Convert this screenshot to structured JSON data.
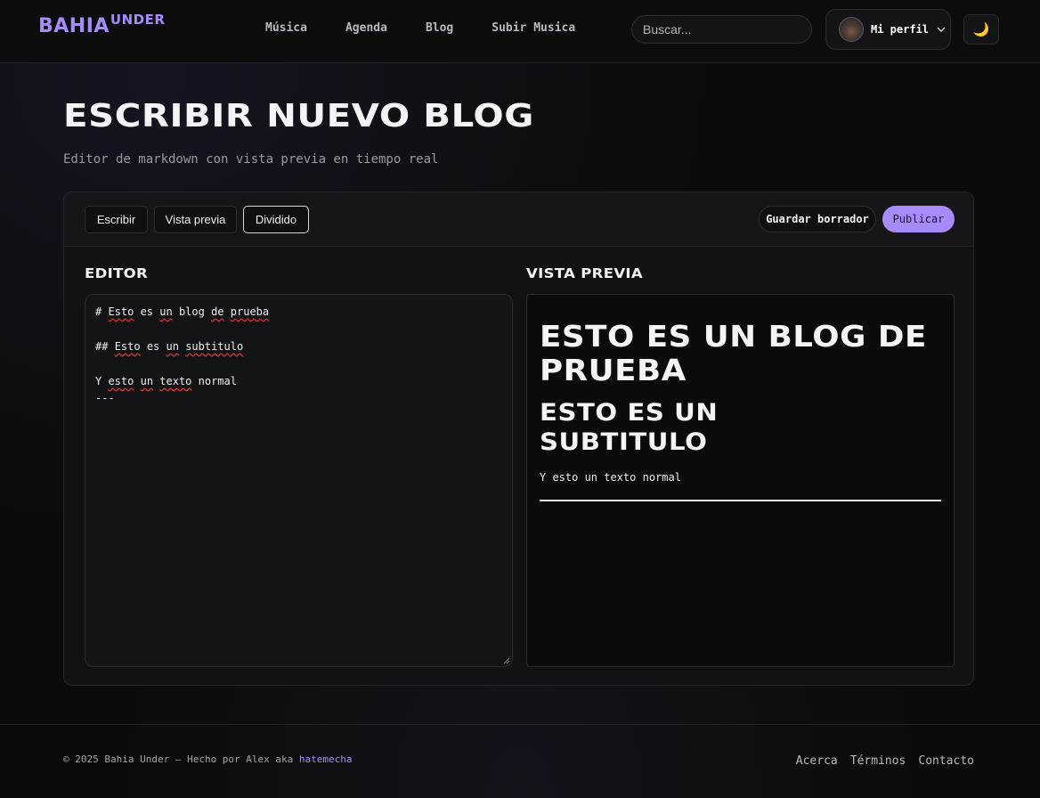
{
  "header": {
    "logo_main": "BAHIA",
    "logo_sup": "UNDER",
    "nav": [
      "Música",
      "Agenda",
      "Blog",
      "Subir Musica"
    ],
    "search_placeholder": "Buscar...",
    "profile_label": "Mi perfil",
    "theme_icon": "🌙"
  },
  "page": {
    "title": "ESCRIBIR NUEVO BLOG",
    "subtitle": "Editor de markdown con vista previa en tiempo real"
  },
  "toolbar": {
    "tabs": [
      "Escribir",
      "Vista previa",
      "Dividido"
    ],
    "active_tab": "Dividido",
    "draft_label": "Guardar borrador",
    "publish_label": "Publicar"
  },
  "editor": {
    "heading": "EDITOR",
    "lines": [
      "# Esto es un blog de prueba",
      "",
      "## Esto es un subtitulo",
      "",
      "Y esto un texto normal",
      "---"
    ]
  },
  "preview": {
    "heading": "VISTA PREVIA",
    "h1": "ESTO ES UN BLOG DE PRUEBA",
    "h2": "ESTO ES UN SUBTITULO",
    "p": "Y esto un texto normal"
  },
  "footer": {
    "copyright": "© 2025 Bahia Under — Hecho por Alex aka ",
    "author_link": "hatemecha",
    "links": [
      "Acerca",
      "Términos",
      "Contacto"
    ]
  },
  "colors": {
    "accent": "#a78bfa",
    "background": "#0b0b0c"
  }
}
